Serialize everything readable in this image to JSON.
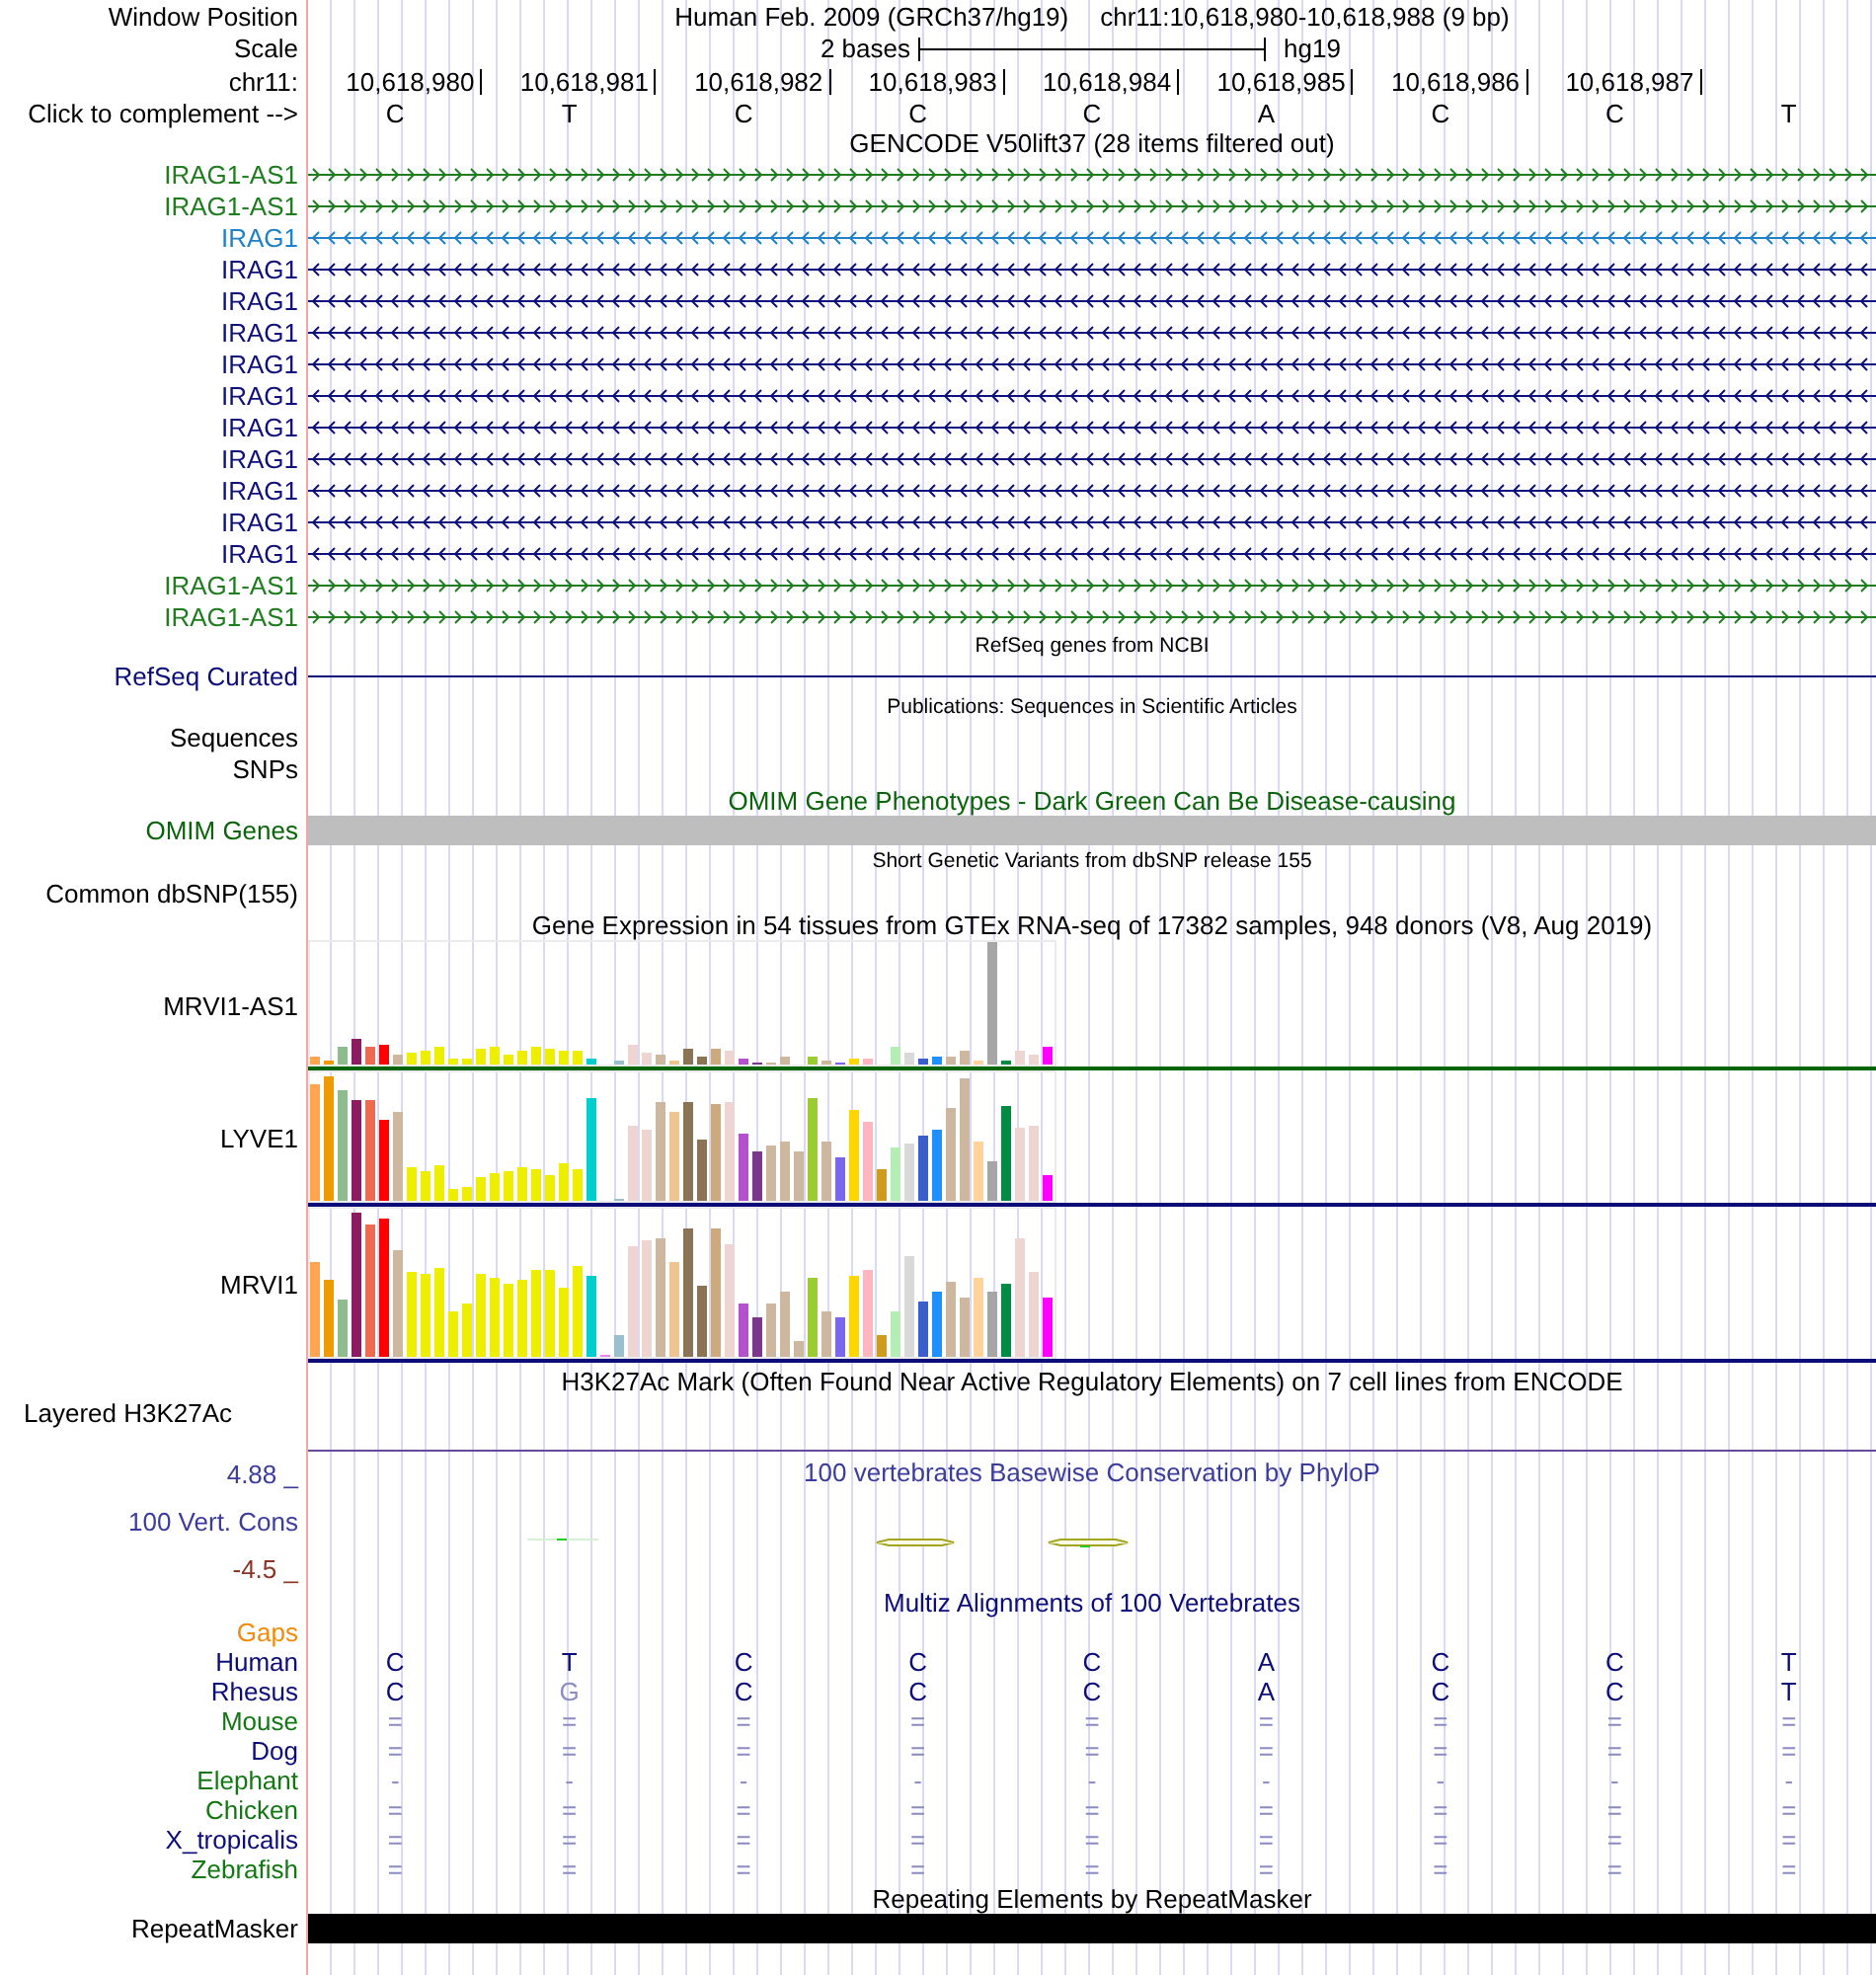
{
  "header": {
    "label": "Window Position",
    "assembly": "Human Feb. 2009 (GRCh37/hg19)",
    "position": "chr11:10,618,980-10,618,988 (9 bp)"
  },
  "scale": {
    "label": "Scale",
    "span": "2 bases",
    "assembly": "hg19"
  },
  "ruler": {
    "label": "chr11:",
    "positions": [
      "10,618,980",
      "10,618,981",
      "10,618,982",
      "10,618,983",
      "10,618,984",
      "10,618,985",
      "10,618,986",
      "10,618,987"
    ]
  },
  "sequence": {
    "label": "Click to complement -->",
    "bases": [
      "C",
      "T",
      "C",
      "C",
      "C",
      "A",
      "C",
      "C",
      "T"
    ]
  },
  "gencode": {
    "title": "GENCODE V50lift37 (28 items filtered out)",
    "genes": [
      {
        "name": "IRAG1-AS1",
        "reverse": false,
        "color": "#1f7d1f"
      },
      {
        "name": "IRAG1-AS1",
        "reverse": false,
        "color": "#1f7d1f"
      },
      {
        "name": "IRAG1",
        "reverse": true,
        "color": "#1f82c8"
      },
      {
        "name": "IRAG1",
        "reverse": true,
        "color": "#10107c"
      },
      {
        "name": "IRAG1",
        "reverse": true,
        "color": "#10107c"
      },
      {
        "name": "IRAG1",
        "reverse": true,
        "color": "#10107c"
      },
      {
        "name": "IRAG1",
        "reverse": true,
        "color": "#10107c"
      },
      {
        "name": "IRAG1",
        "reverse": true,
        "color": "#10107c"
      },
      {
        "name": "IRAG1",
        "reverse": true,
        "color": "#10107c"
      },
      {
        "name": "IRAG1",
        "reverse": true,
        "color": "#10107c"
      },
      {
        "name": "IRAG1",
        "reverse": true,
        "color": "#10107c"
      },
      {
        "name": "IRAG1",
        "reverse": true,
        "color": "#10107c"
      },
      {
        "name": "IRAG1",
        "reverse": true,
        "color": "#10107c"
      },
      {
        "name": "IRAG1-AS1",
        "reverse": false,
        "color": "#1f7d1f"
      },
      {
        "name": "IRAG1-AS1",
        "reverse": false,
        "color": "#1f7d1f"
      }
    ]
  },
  "refseq": {
    "title": "RefSeq genes from NCBI",
    "label": "RefSeq Curated"
  },
  "publications": {
    "title": "Publications: Sequences in Scientific Articles",
    "tracks": [
      "Sequences",
      "SNPs"
    ]
  },
  "omim": {
    "title": "OMIM Gene Phenotypes - Dark Green Can Be Disease-causing",
    "label": "OMIM Genes"
  },
  "dbsnp": {
    "title": "Short Genetic Variants from dbSNP release 155",
    "label": "Common dbSNP(155)"
  },
  "gtex": {
    "title": "Gene Expression in 54 tissues from GTEx RNA-seq of 17382 samples, 948 donors (V8, Aug 2019)",
    "genes": [
      {
        "name": "MRVI1-AS1",
        "color": "#006400"
      },
      {
        "name": "LYVE1",
        "color": "#0c0c78"
      },
      {
        "name": "MRVI1",
        "color": "#0c0c78"
      }
    ]
  },
  "h3k27ac": {
    "title": "H3K27Ac Mark (Often Found Near Active Regulatory Elements) on 7 cell lines from ENCODE",
    "label": "Layered H3K27Ac"
  },
  "conservation": {
    "title": "100 vertebrates Basewise Conservation by PhyloP",
    "label": "100 Vert. Cons",
    "max_label": "4.88 _",
    "min_label": "-4.5 _"
  },
  "multiz": {
    "title": "Multiz Alignments of 100 Vertebrates",
    "gaps_label": "Gaps",
    "species": [
      {
        "name": "Human",
        "color": "#0c0c78",
        "cells": [
          {
            "text": "C",
            "dimmed": false
          },
          {
            "text": "T",
            "dimmed": false
          },
          {
            "text": "C",
            "dimmed": false
          },
          {
            "text": "C",
            "dimmed": false
          },
          {
            "text": "C",
            "dimmed": false
          },
          {
            "text": "A",
            "dimmed": false
          },
          {
            "text": "C",
            "dimmed": false
          },
          {
            "text": "C",
            "dimmed": false
          },
          {
            "text": "T",
            "dimmed": false
          }
        ]
      },
      {
        "name": "Rhesus",
        "color": "#0c0c78",
        "cells": [
          {
            "text": "C",
            "dimmed": false
          },
          {
            "text": "G",
            "dimmed": true
          },
          {
            "text": "C",
            "dimmed": false
          },
          {
            "text": "C",
            "dimmed": false
          },
          {
            "text": "C",
            "dimmed": false
          },
          {
            "text": "A",
            "dimmed": false
          },
          {
            "text": "C",
            "dimmed": false
          },
          {
            "text": "C",
            "dimmed": false
          },
          {
            "text": "T",
            "dimmed": false
          }
        ]
      },
      {
        "name": "Mouse",
        "color": "#137813",
        "cells": [
          {
            "text": "=",
            "dimmed": true
          },
          {
            "text": "=",
            "dimmed": true
          },
          {
            "text": "=",
            "dimmed": true
          },
          {
            "text": "=",
            "dimmed": true
          },
          {
            "text": "=",
            "dimmed": true
          },
          {
            "text": "=",
            "dimmed": true
          },
          {
            "text": "=",
            "dimmed": true
          },
          {
            "text": "=",
            "dimmed": true
          },
          {
            "text": "=",
            "dimmed": true
          }
        ]
      },
      {
        "name": "Dog",
        "color": "#0c0c78",
        "cells": [
          {
            "text": "=",
            "dimmed": true
          },
          {
            "text": "=",
            "dimmed": true
          },
          {
            "text": "=",
            "dimmed": true
          },
          {
            "text": "=",
            "dimmed": true
          },
          {
            "text": "=",
            "dimmed": true
          },
          {
            "text": "=",
            "dimmed": true
          },
          {
            "text": "=",
            "dimmed": true
          },
          {
            "text": "=",
            "dimmed": true
          },
          {
            "text": "=",
            "dimmed": true
          }
        ]
      },
      {
        "name": "Elephant",
        "color": "#137813",
        "cells": [
          {
            "text": "-",
            "dimmed": true
          },
          {
            "text": "-",
            "dimmed": true
          },
          {
            "text": "-",
            "dimmed": true
          },
          {
            "text": "-",
            "dimmed": true
          },
          {
            "text": "-",
            "dimmed": true
          },
          {
            "text": "-",
            "dimmed": true
          },
          {
            "text": "-",
            "dimmed": true
          },
          {
            "text": "-",
            "dimmed": true
          },
          {
            "text": "-",
            "dimmed": true
          }
        ]
      },
      {
        "name": "Chicken",
        "color": "#137813",
        "cells": [
          {
            "text": "=",
            "dimmed": true
          },
          {
            "text": "=",
            "dimmed": true
          },
          {
            "text": "=",
            "dimmed": true
          },
          {
            "text": "=",
            "dimmed": true
          },
          {
            "text": "=",
            "dimmed": true
          },
          {
            "text": "=",
            "dimmed": true
          },
          {
            "text": "=",
            "dimmed": true
          },
          {
            "text": "=",
            "dimmed": true
          },
          {
            "text": "=",
            "dimmed": true
          }
        ]
      },
      {
        "name": "X_tropicalis",
        "color": "#0c0c78",
        "cells": [
          {
            "text": "=",
            "dimmed": true
          },
          {
            "text": "=",
            "dimmed": true
          },
          {
            "text": "=",
            "dimmed": true
          },
          {
            "text": "=",
            "dimmed": true
          },
          {
            "text": "=",
            "dimmed": true
          },
          {
            "text": "=",
            "dimmed": true
          },
          {
            "text": "=",
            "dimmed": true
          },
          {
            "text": "=",
            "dimmed": true
          },
          {
            "text": "=",
            "dimmed": true
          }
        ]
      },
      {
        "name": "Zebrafish",
        "color": "#137813",
        "cells": [
          {
            "text": "=",
            "dimmed": true
          },
          {
            "text": "=",
            "dimmed": true
          },
          {
            "text": "=",
            "dimmed": true
          },
          {
            "text": "=",
            "dimmed": true
          },
          {
            "text": "=",
            "dimmed": true
          },
          {
            "text": "=",
            "dimmed": true
          },
          {
            "text": "=",
            "dimmed": true
          },
          {
            "text": "=",
            "dimmed": true
          },
          {
            "text": "=",
            "dimmed": true
          }
        ]
      }
    ]
  },
  "repeatmasker": {
    "title": "Repeating Elements by RepeatMasker",
    "label": "RepeatMasker"
  }
}
